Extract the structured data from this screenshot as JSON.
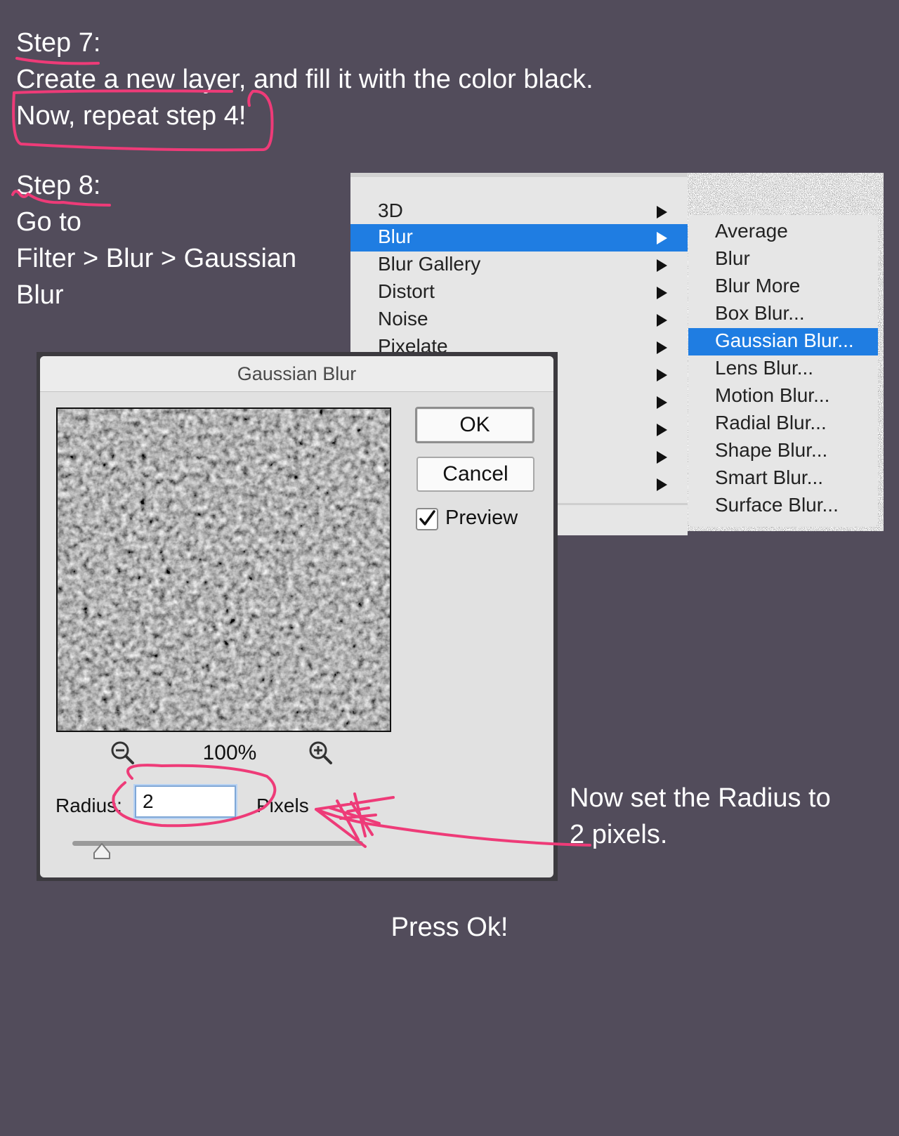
{
  "steps": {
    "step7_label": "Step 7:",
    "step7_line1": "Create a new layer, and fill it with the color black.",
    "step7_line2": "Now, repeat step 4!",
    "step8_label": "Step 8:",
    "step8_line1": "Go to",
    "step8_line2": "Filter > Blur > Gaussian",
    "step8_line3": "Blur"
  },
  "filter_menu": {
    "items": [
      {
        "label": "3D",
        "has_submenu": true
      },
      {
        "label": "Blur",
        "has_submenu": true,
        "highlighted": true
      },
      {
        "label": "Blur Gallery",
        "has_submenu": true
      },
      {
        "label": "Distort",
        "has_submenu": true
      },
      {
        "label": "Noise",
        "has_submenu": true
      },
      {
        "label": "Pixelate",
        "has_submenu": true
      }
    ]
  },
  "blur_submenu": {
    "items": [
      {
        "label": "Average"
      },
      {
        "label": "Blur"
      },
      {
        "label": "Blur More"
      },
      {
        "label": "Box Blur..."
      },
      {
        "label": "Gaussian Blur...",
        "highlighted": true
      },
      {
        "label": "Lens Blur..."
      },
      {
        "label": "Motion Blur..."
      },
      {
        "label": "Radial Blur..."
      },
      {
        "label": "Shape Blur..."
      },
      {
        "label": "Smart Blur..."
      },
      {
        "label": "Surface Blur..."
      }
    ]
  },
  "dialog": {
    "title": "Gaussian Blur",
    "ok_label": "OK",
    "cancel_label": "Cancel",
    "preview_label": "Preview",
    "preview_checked": true,
    "zoom_level": "100%",
    "radius_label": "Radius:",
    "radius_value": "2",
    "units_label": "Pixels",
    "slider_position": 0.07
  },
  "annotation": {
    "line1": "Now set the Radius to",
    "line2": "2 pixels.",
    "press_ok": "Press Ok!"
  },
  "colors": {
    "background": "#524c5b",
    "highlight": "#1f7de2",
    "annotation_pink": "#ee3b78"
  },
  "icons": [
    "zoom-out-icon",
    "zoom-in-icon",
    "checkmark-icon",
    "submenu-arrow-icon",
    "slider-thumb-icon"
  ]
}
